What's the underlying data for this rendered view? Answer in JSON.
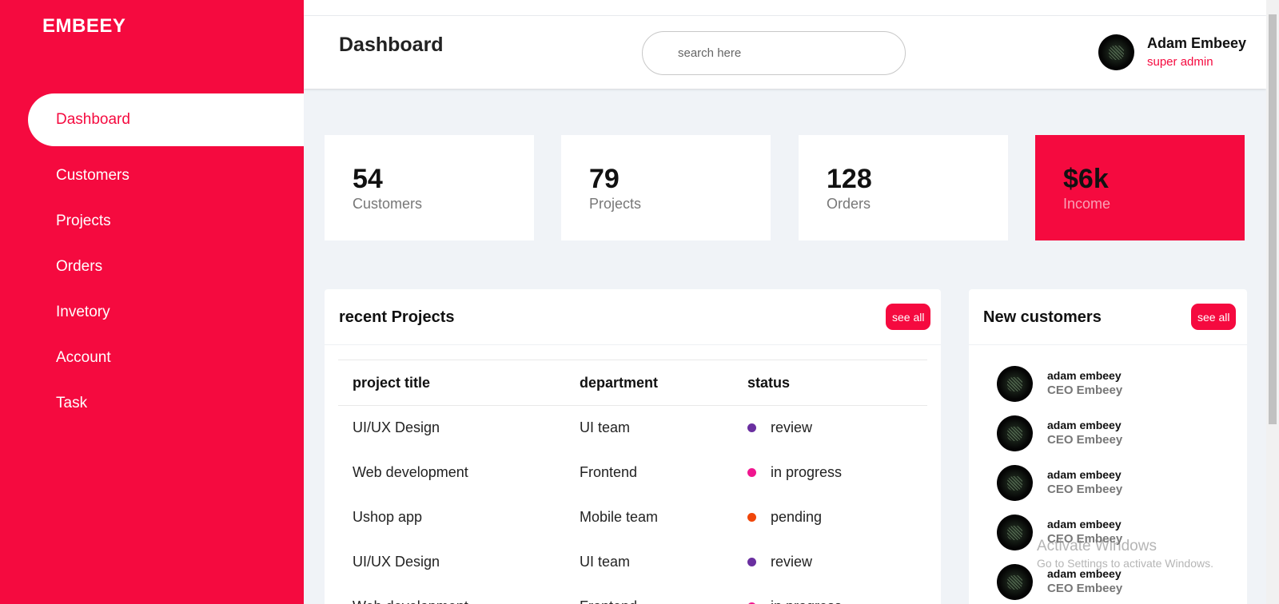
{
  "brand": "EMBEEY",
  "sidebar": {
    "items": [
      {
        "label": "Dashboard",
        "active": true
      },
      {
        "label": "Customers"
      },
      {
        "label": "Projects"
      },
      {
        "label": "Orders"
      },
      {
        "label": "Invetory"
      },
      {
        "label": "Account"
      },
      {
        "label": "Task"
      }
    ]
  },
  "header": {
    "title": "Dashboard",
    "search_placeholder": "search here",
    "user": {
      "name": "Adam Embeey",
      "role": "super admin"
    }
  },
  "cards": [
    {
      "value": "54",
      "label": "Customers"
    },
    {
      "value": "79",
      "label": "Projects"
    },
    {
      "value": "128",
      "label": "Orders"
    },
    {
      "value": "$6k",
      "label": "Income"
    }
  ],
  "projects": {
    "title": "recent Projects",
    "see_all": "see all",
    "columns": [
      "project title",
      "department",
      "status"
    ],
    "rows": [
      {
        "title": "UI/UX Design",
        "department": "UI team",
        "status": "review",
        "color": "#6a2fa0"
      },
      {
        "title": "Web development",
        "department": "Frontend",
        "status": "in progress",
        "color": "#f0168f"
      },
      {
        "title": "Ushop app",
        "department": "Mobile team",
        "status": "pending",
        "color": "#f0460a"
      },
      {
        "title": "UI/UX Design",
        "department": "UI team",
        "status": "review",
        "color": "#6a2fa0"
      },
      {
        "title": "Web development",
        "department": "Frontend",
        "status": "in progress",
        "color": "#f0168f"
      }
    ]
  },
  "customers": {
    "title": "New customers",
    "see_all": "see all",
    "items": [
      {
        "name": "adam embeey",
        "title": "CEO Embeey"
      },
      {
        "name": "adam embeey",
        "title": "CEO Embeey"
      },
      {
        "name": "adam embeey",
        "title": "CEO Embeey"
      },
      {
        "name": "adam embeey",
        "title": "CEO Embeey"
      },
      {
        "name": "adam embeey",
        "title": "CEO Embeey"
      }
    ]
  },
  "watermark": {
    "line1": "Activate Windows",
    "line2": "Go to Settings to activate Windows."
  },
  "colors": {
    "accent": "#f50a3f",
    "background": "#f0f3f7"
  }
}
